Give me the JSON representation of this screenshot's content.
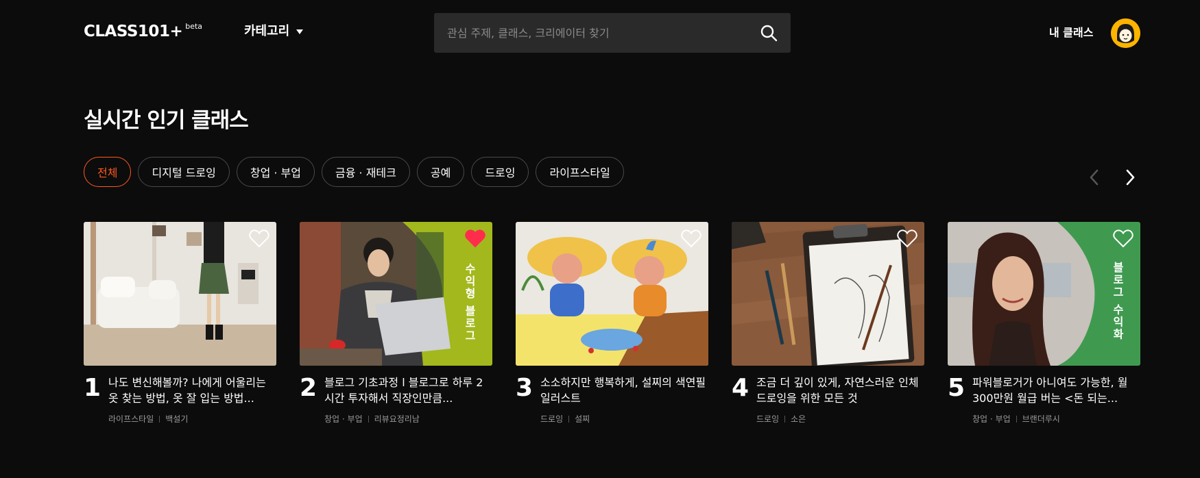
{
  "header": {
    "logo": "CLASS101+",
    "logo_badge": "beta",
    "category_label": "카테고리",
    "search_placeholder": "관심 주제, 클래스, 크리에이터 찾기",
    "my_class": "내 클래스"
  },
  "section": {
    "title": "실시간 인기 클래스",
    "chips": [
      {
        "label": "전체",
        "active": true
      },
      {
        "label": "디지털 드로잉",
        "active": false
      },
      {
        "label": "창업 · 부업",
        "active": false
      },
      {
        "label": "금융 · 재테크",
        "active": false
      },
      {
        "label": "공예",
        "active": false
      },
      {
        "label": "드로잉",
        "active": false
      },
      {
        "label": "라이프스타일",
        "active": false
      }
    ]
  },
  "cards": [
    {
      "rank": "1",
      "title": "나도 변신해볼까? 나에게 어울리는 옷 찾는 방법, 옷 잘 입는 방법...",
      "category": "라이프스타일",
      "creator": "백설기",
      "liked": false,
      "overlay": ""
    },
    {
      "rank": "2",
      "title": "블로그 기초과정 l 블로그로 하루 2시간 투자해서 직장인만큼...",
      "category": "창업 · 부업",
      "creator": "리뷰요정리남",
      "liked": true,
      "overlay": "수익형 블로그"
    },
    {
      "rank": "3",
      "title": "소소하지만 행복하게, 설찌의 색연필 일러스트",
      "category": "드로잉",
      "creator": "설찌",
      "liked": false,
      "overlay": ""
    },
    {
      "rank": "4",
      "title": "조금 더 깊이 있게, 자연스러운 인체 드로잉을 위한 모든 것",
      "category": "드로잉",
      "creator": "소은",
      "liked": false,
      "overlay": ""
    },
    {
      "rank": "5",
      "title": "파워블로거가 아니여도 가능한, 월 300만원 월급 버는 <돈 되는...",
      "category": "창업 · 부업",
      "creator": "브랜더루시",
      "liked": false,
      "overlay": "블로그 수익화"
    }
  ],
  "colors": {
    "background": "#0c0c0c",
    "accent": "#ff5a1f",
    "heart_liked": "#ff2d4b",
    "card2_banner": "#a3b81c",
    "card5_banner": "#3f9a4f"
  }
}
